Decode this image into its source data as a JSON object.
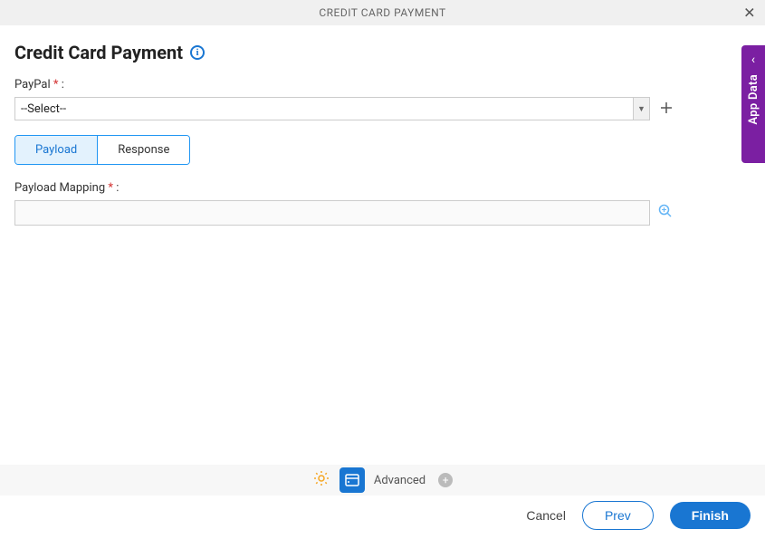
{
  "header": {
    "title_upper": "CREDIT CARD PAYMENT"
  },
  "page": {
    "title": "Credit Card Payment"
  },
  "fields": {
    "paypal_label": "PayPal",
    "paypal_colon": " :",
    "select_placeholder": "--Select--",
    "payload_mapping_label": "Payload Mapping",
    "payload_mapping_colon": " :",
    "payload_mapping_value": ""
  },
  "tabs": {
    "payload": "Payload",
    "response": "Response"
  },
  "footer": {
    "advanced": "Advanced",
    "cancel": "Cancel",
    "prev": "Prev",
    "finish": "Finish"
  },
  "side": {
    "label": "App Data"
  }
}
